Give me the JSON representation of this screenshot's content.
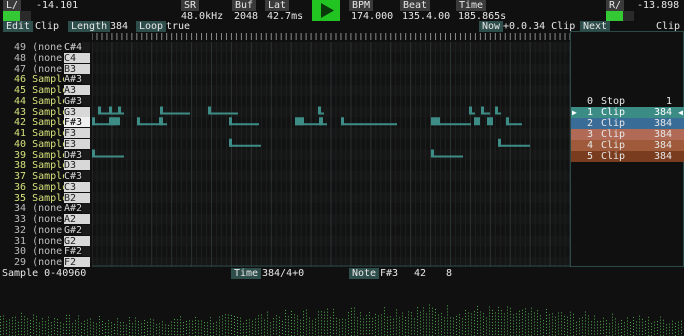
{
  "top": {
    "left_label": "L/",
    "left_value": "-14.101",
    "sr_label": "SR",
    "sr_value": "48.0kHz",
    "buf_label": "Buf",
    "buf_value": "2048",
    "lat_label": "Lat",
    "lat_value": "42.7ms",
    "bpm_label": "BPM",
    "bpm_value": "174.000",
    "beat_label": "Beat",
    "beat_value": "135.4.00",
    "time_label": "Time",
    "time_value": "185.865s",
    "right_label": "R/",
    "right_value": "-13.898",
    "left_meter_level": 0.6,
    "right_meter_level": 0.6
  },
  "clipbar": {
    "edit_label": "Edit",
    "clip_word": "Clip",
    "length_label": "Length",
    "length_value": "384",
    "loop_label": "Loop",
    "loop_value": "true",
    "now_label": "Now",
    "now_value": "+0.0.34 Clip",
    "next_label": "Next",
    "next_value": "Clip"
  },
  "keys": [
    {
      "num": "49",
      "name": "(none)",
      "note": "C#4",
      "on": false
    },
    {
      "num": "48",
      "name": "(none)",
      "note": "C4",
      "on": false
    },
    {
      "num": "47",
      "name": "(none)",
      "note": "B3",
      "on": false
    },
    {
      "num": "46",
      "name": "Sample",
      "note": "A#3",
      "on": true
    },
    {
      "num": "45",
      "name": "Sample",
      "note": "A3",
      "on": true
    },
    {
      "num": "44",
      "name": "Sample",
      "note": "G#3",
      "on": true
    },
    {
      "num": "43",
      "name": "Sample",
      "note": "G3",
      "on": true
    },
    {
      "num": "42",
      "name": "Sample",
      "note": "F#3",
      "on": true
    },
    {
      "num": "41",
      "name": "Sample",
      "note": "F3",
      "on": true
    },
    {
      "num": "40",
      "name": "Sample",
      "note": "E3",
      "on": true
    },
    {
      "num": "39",
      "name": "Sample",
      "note": "D#3",
      "on": true
    },
    {
      "num": "38",
      "name": "Sample",
      "note": "D3",
      "on": true
    },
    {
      "num": "37",
      "name": "Sample",
      "note": "C#3",
      "on": true
    },
    {
      "num": "36",
      "name": "Sample",
      "note": "C3",
      "on": true
    },
    {
      "num": "35",
      "name": "Sample",
      "note": "B2",
      "on": true
    },
    {
      "num": "34",
      "name": "(none)",
      "note": "A#2",
      "on": false
    },
    {
      "num": "33",
      "name": "(none)",
      "note": "A2",
      "on": false
    },
    {
      "num": "32",
      "name": "(none)",
      "note": "G#2",
      "on": false
    },
    {
      "num": "31",
      "name": "(none)",
      "note": "G2",
      "on": false
    },
    {
      "num": "30",
      "name": "(none)",
      "note": "F#2",
      "on": false
    },
    {
      "num": "29",
      "name": "(none)",
      "note": "F2",
      "on": false
    }
  ],
  "clips": [
    {
      "index": "0",
      "name": "Stop",
      "len": "1",
      "color": "#141414",
      "selected": false
    },
    {
      "index": "1",
      "name": "Clip",
      "len": "384",
      "color": "#3c8c86",
      "selected": true
    },
    {
      "index": "2",
      "name": "Clip",
      "len": "384",
      "color": "#3a6c98",
      "selected": false
    },
    {
      "index": "3",
      "name": "Clip",
      "len": "384",
      "color": "#b06a55",
      "selected": false
    },
    {
      "index": "4",
      "name": "Clip",
      "len": "384",
      "color": "#9e5a3a",
      "selected": false
    },
    {
      "index": "5",
      "name": "Clip",
      "len": "384",
      "color": "#7a3c1e",
      "selected": false
    }
  ],
  "bottom": {
    "sample_range": "Sample 0-40960",
    "time_label": "Time",
    "time_value": "384/4+0",
    "note_label": "Note",
    "note_value": "F#3",
    "note_number": "42",
    "velocity": "8"
  },
  "colors": {
    "accent": "#2e4e4c",
    "note_line": "#3d8c86",
    "play_button": "#22c422",
    "meter": "#35c835",
    "waveform": "#4caa4c"
  },
  "icons": {
    "play": "play-triangle-icon",
    "selected_clip_left": "right-pointer-icon",
    "selected_clip_right": "left-pointer-icon"
  }
}
